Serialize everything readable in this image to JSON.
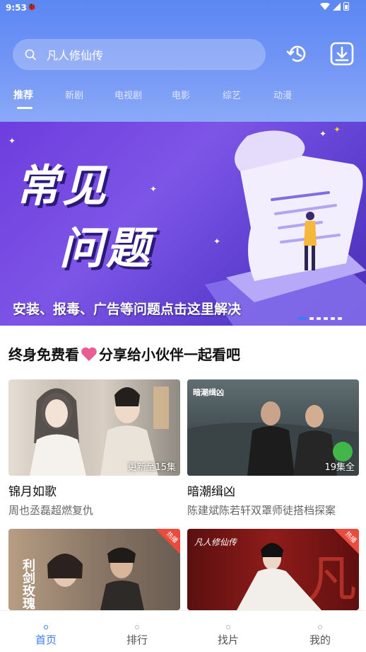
{
  "status": {
    "time": "9:53"
  },
  "search": {
    "placeholder": "凡人修仙传"
  },
  "tabs": [
    "推荐",
    "新剧",
    "电视剧",
    "电影",
    "综艺",
    "动漫"
  ],
  "banner": {
    "title_line1": "常见",
    "title_line2": "问题",
    "caption": "安装、报毒、广告等问题点击这里解决",
    "slide_count": 6,
    "active_slide": 0
  },
  "share": {
    "text_before": "终身免费看",
    "text_after": "分享给小伙伴一起看吧"
  },
  "cards": [
    {
      "title": "锦月如歌",
      "desc": "周也丞磊超燃复仇",
      "badge": "更新至15集",
      "poster_text": ""
    },
    {
      "title": "暗潮缉凶",
      "desc": "陈建斌陈若轩双罩师徒搭档探案",
      "badge": "19集全",
      "poster_text": "暗潮缉凶"
    },
    {
      "title": "",
      "desc": "",
      "badge": "",
      "poster_text": "利剑玫瑰",
      "hot": "热播"
    },
    {
      "title": "",
      "desc": "",
      "badge": "",
      "poster_text": "凡人修仙传",
      "hot": "热播"
    }
  ],
  "bottom_nav": [
    "首页",
    "排行",
    "找片",
    "我的"
  ],
  "colors": {
    "accent": "#3d7af5",
    "header": "#5c88f2",
    "banner": "#6e3dde",
    "heart": "#e95d94"
  }
}
